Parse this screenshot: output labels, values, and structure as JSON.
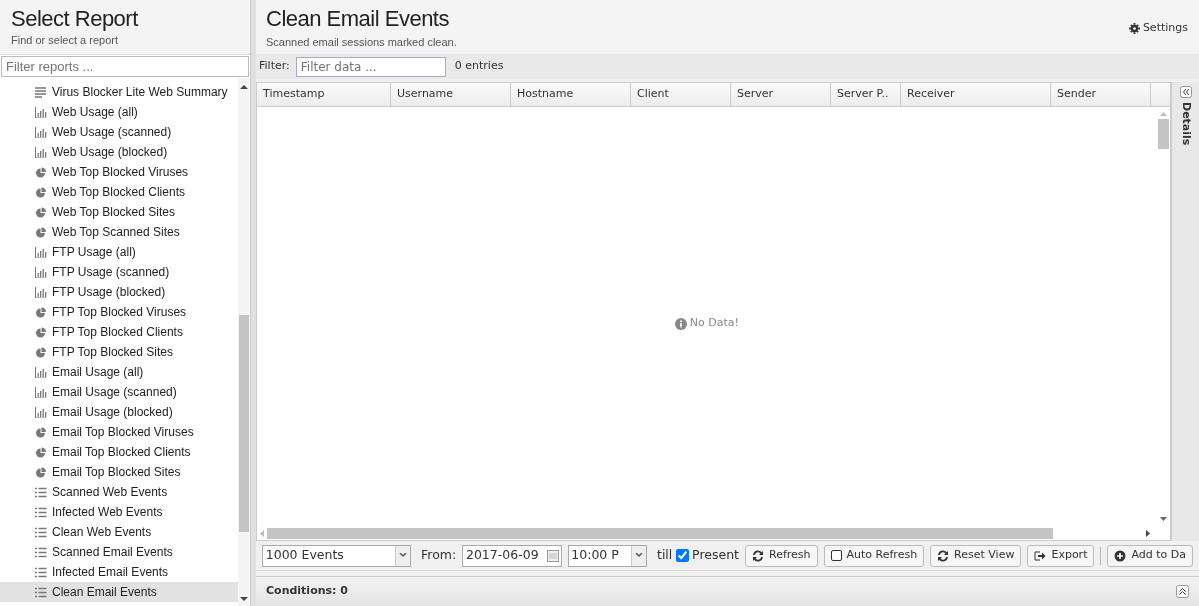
{
  "sidebar": {
    "title": "Select Report",
    "subtitle": "Find or select a report",
    "filter_placeholder": "Filter reports ...",
    "items": [
      {
        "label": "Virus Blocker Lite Web Summary",
        "kind": "summary",
        "selected": false
      },
      {
        "label": "Web Usage (all)",
        "kind": "bar",
        "selected": false
      },
      {
        "label": "Web Usage (scanned)",
        "kind": "bar",
        "selected": false
      },
      {
        "label": "Web Usage (blocked)",
        "kind": "bar",
        "selected": false
      },
      {
        "label": "Web Top Blocked Viruses",
        "kind": "pie",
        "selected": false
      },
      {
        "label": "Web Top Blocked Clients",
        "kind": "pie",
        "selected": false
      },
      {
        "label": "Web Top Blocked Sites",
        "kind": "pie",
        "selected": false
      },
      {
        "label": "Web Top Scanned Sites",
        "kind": "pie",
        "selected": false
      },
      {
        "label": "FTP Usage (all)",
        "kind": "bar",
        "selected": false
      },
      {
        "label": "FTP Usage (scanned)",
        "kind": "bar",
        "selected": false
      },
      {
        "label": "FTP Usage (blocked)",
        "kind": "bar",
        "selected": false
      },
      {
        "label": "FTP Top Blocked Viruses",
        "kind": "pie",
        "selected": false
      },
      {
        "label": "FTP Top Blocked Clients",
        "kind": "pie",
        "selected": false
      },
      {
        "label": "FTP Top Blocked Sites",
        "kind": "pie",
        "selected": false
      },
      {
        "label": "Email Usage (all)",
        "kind": "bar",
        "selected": false
      },
      {
        "label": "Email Usage (scanned)",
        "kind": "bar",
        "selected": false
      },
      {
        "label": "Email Usage (blocked)",
        "kind": "bar",
        "selected": false
      },
      {
        "label": "Email Top Blocked Viruses",
        "kind": "pie",
        "selected": false
      },
      {
        "label": "Email Top Blocked Clients",
        "kind": "pie",
        "selected": false
      },
      {
        "label": "Email Top Blocked Sites",
        "kind": "pie",
        "selected": false
      },
      {
        "label": "Scanned Web Events",
        "kind": "list",
        "selected": false
      },
      {
        "label": "Infected Web Events",
        "kind": "list",
        "selected": false
      },
      {
        "label": "Clean Web Events",
        "kind": "list",
        "selected": false
      },
      {
        "label": "Scanned Email Events",
        "kind": "list",
        "selected": false
      },
      {
        "label": "Infected Email Events",
        "kind": "list",
        "selected": false
      },
      {
        "label": "Clean Email Events",
        "kind": "list",
        "selected": true
      }
    ]
  },
  "header": {
    "title": "Clean Email Events",
    "subtitle": "Scanned email sessions marked clean.",
    "settings": "Settings"
  },
  "filter": {
    "label": "Filter:",
    "placeholder": "Filter data ...",
    "count": "0 entries"
  },
  "table": {
    "columns": [
      "Timestamp",
      "Username",
      "Hostname",
      "Client",
      "Server",
      "Server P..",
      "Receiver",
      "Sender"
    ],
    "empty_message": "No Data!"
  },
  "details_panel": {
    "title": "Details"
  },
  "toolbar": {
    "limit": "1000 Events",
    "from_label": "From:",
    "date": "2017-06-09",
    "time": "10:00 P",
    "till_label": "till",
    "present": {
      "label": "Present",
      "checked": true
    },
    "buttons": [
      {
        "label": "Refresh",
        "kind": "refresh"
      },
      {
        "label": "Auto Refresh",
        "kind": "toggle",
        "checked": false
      },
      {
        "label": "Reset View",
        "kind": "refresh"
      },
      {
        "label": "Export",
        "kind": "export"
      },
      {
        "label": "Add to Da",
        "kind": "add"
      }
    ]
  },
  "conditions": "Conditions: 0"
}
